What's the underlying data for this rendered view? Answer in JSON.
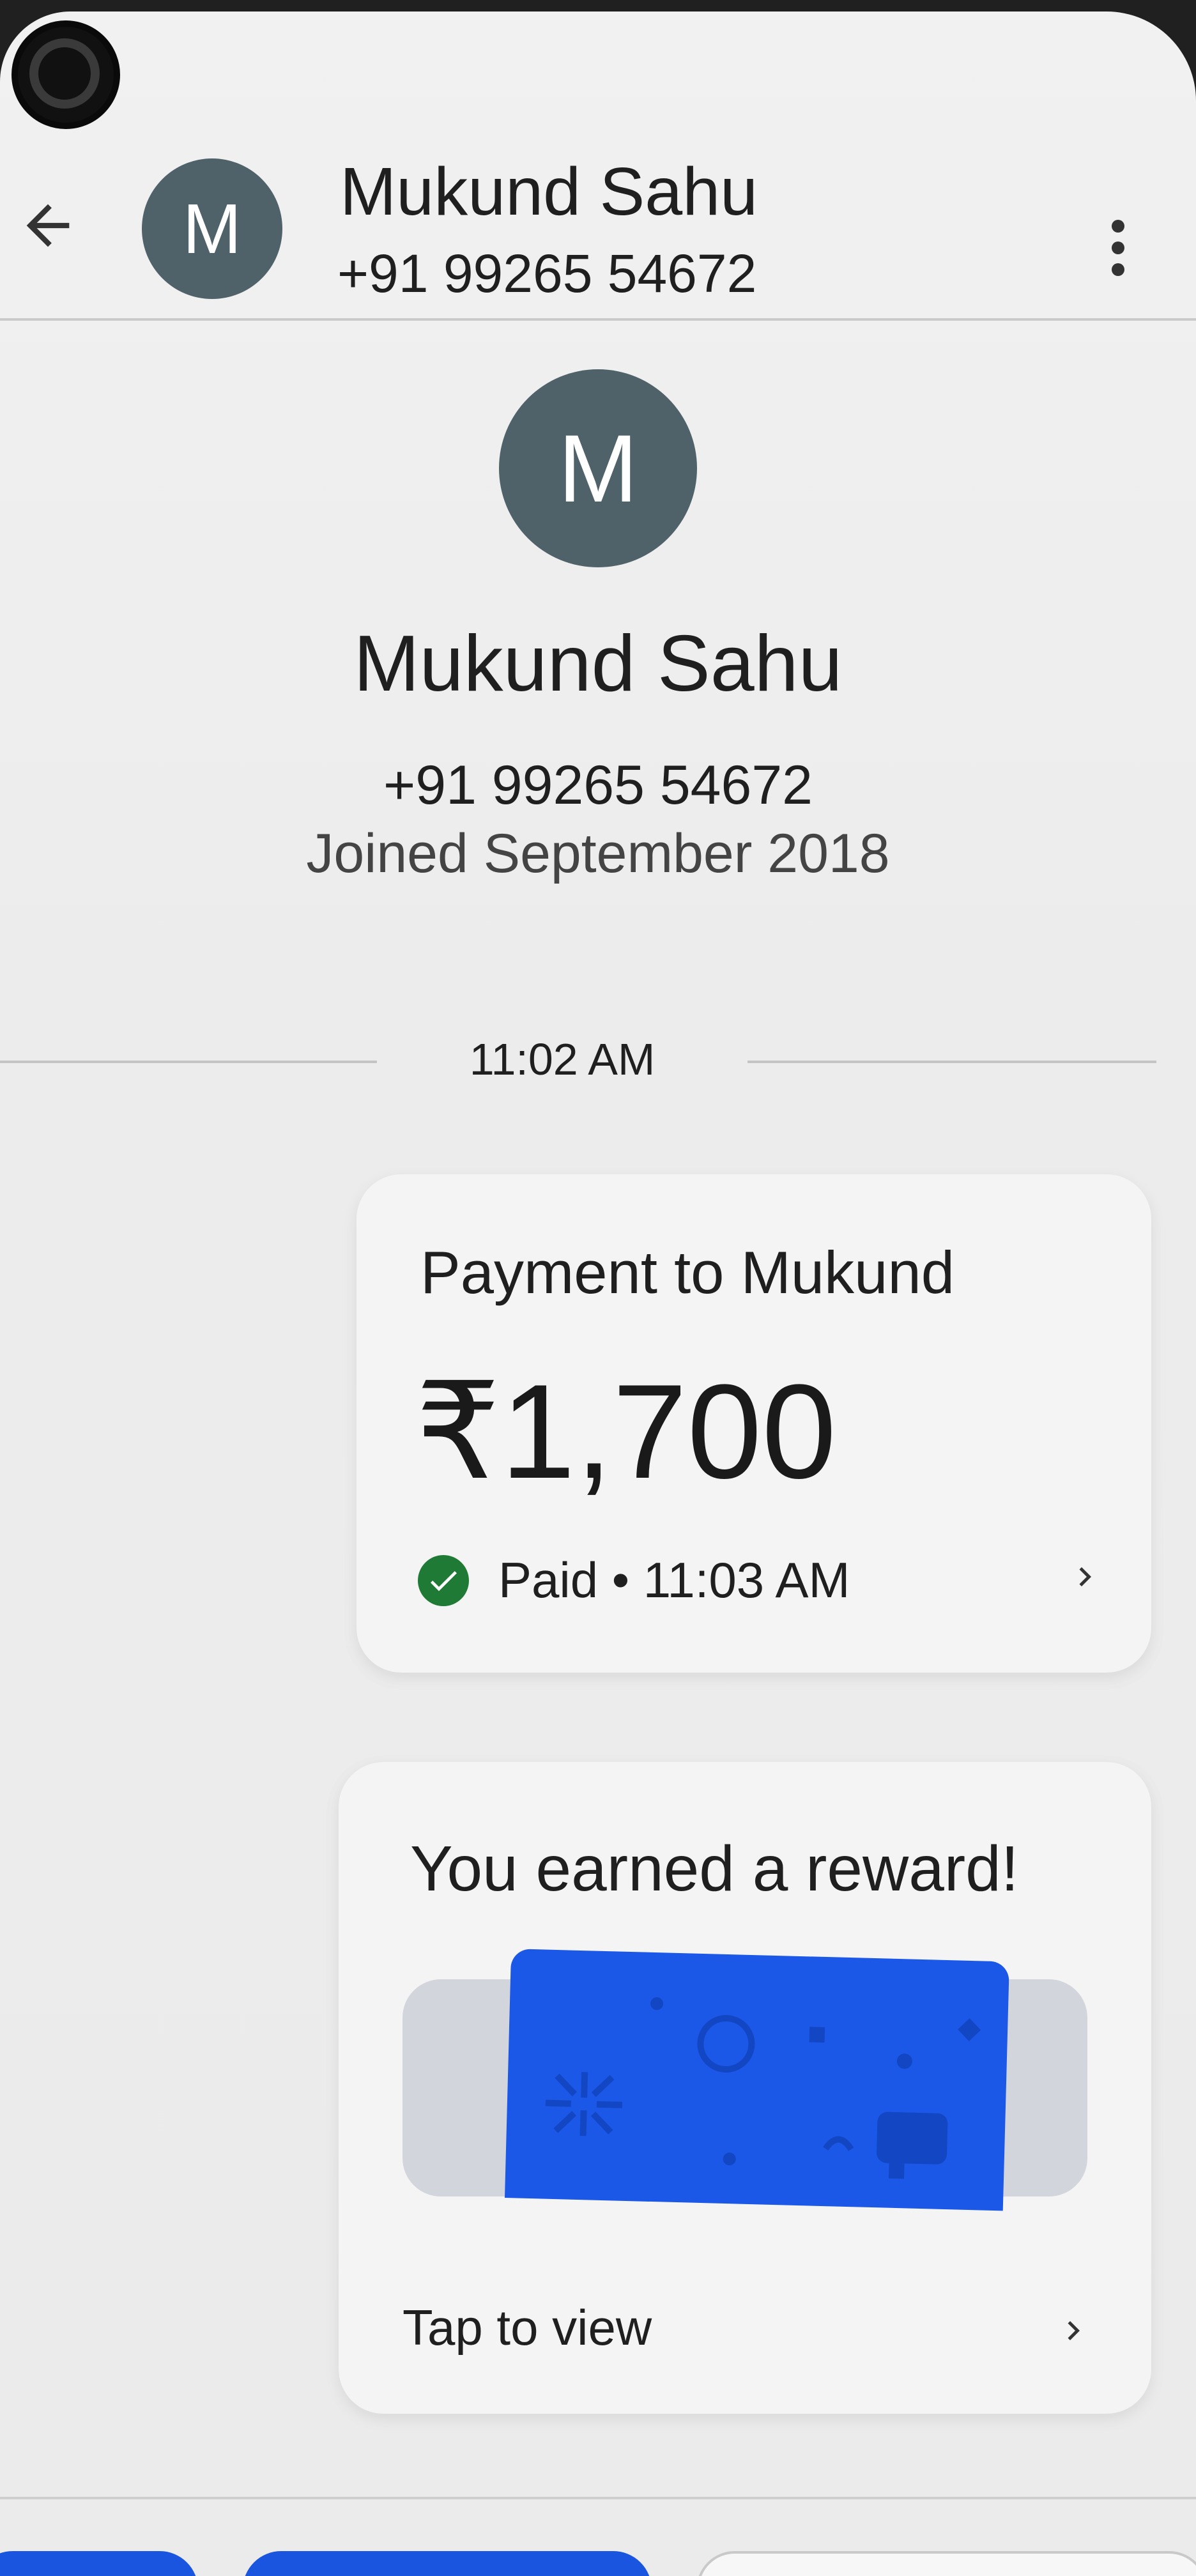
{
  "header": {
    "back_icon": "arrow-left-icon",
    "avatar_initial": "M",
    "name": "Mukund Sahu",
    "phone": "+91 99265 54672",
    "menu_icon": "more-vertical-icon"
  },
  "profile": {
    "avatar_initial": "M",
    "name": "Mukund Sahu",
    "phone": "+91 99265 54672",
    "joined": "Joined September 2018"
  },
  "timeline": {
    "time": "11:02 AM"
  },
  "payment": {
    "title": "Payment to Mukund",
    "amount": "₹1,700",
    "status": "Paid • 11:03 AM",
    "status_icon": "check-circle-icon",
    "status_color": "#1e7a34"
  },
  "reward": {
    "title": "You earned a reward!",
    "action": "Tap to view",
    "card_color": "#1b58e8"
  },
  "colors": {
    "avatar": "#4f6169",
    "accent": "#1a55e0"
  }
}
